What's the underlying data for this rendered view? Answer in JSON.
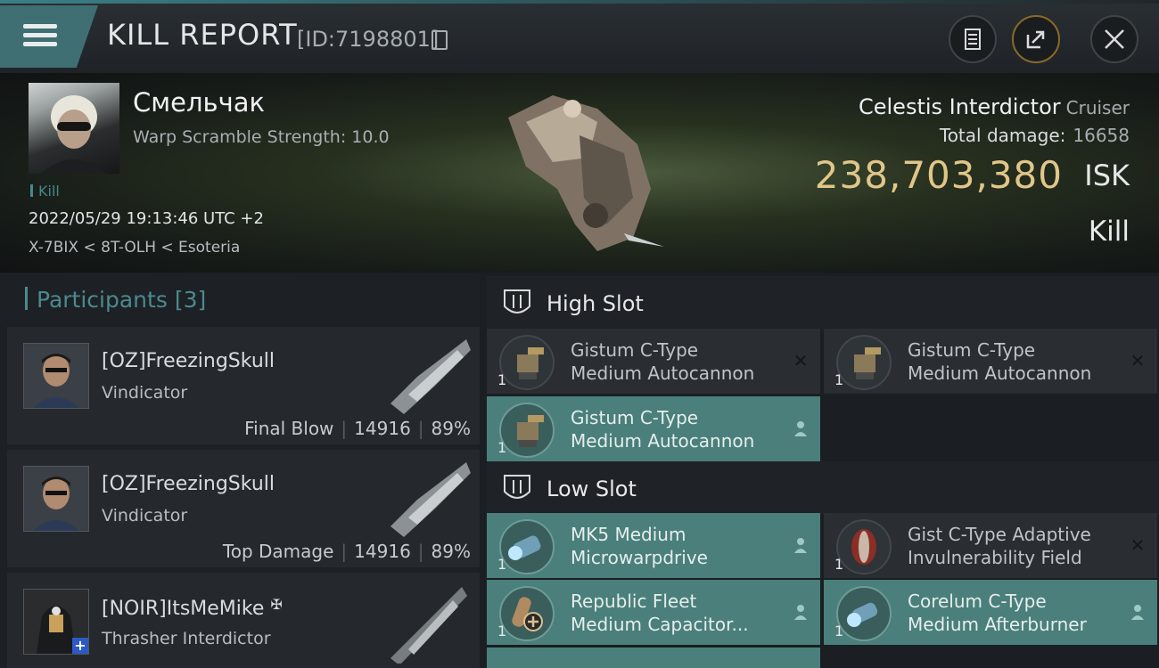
{
  "header": {
    "title": "KILL REPORT",
    "report_id": "[ID:7198801]",
    "icons": [
      "menu-icon",
      "copy-icon",
      "clipboard-icon",
      "share-icon",
      "close-icon"
    ]
  },
  "victim": {
    "name": "Смельчак",
    "warp_scramble": "Warp Scramble Strength: 10.0",
    "tag": "Kill",
    "datetime": "2022/05/29 19:13:46 UTC +2",
    "location": "X-7BIX < 8T-OLH < Esoteria",
    "ship_name": "Celestis Interdictor",
    "ship_class": "Cruiser",
    "total_damage_label": "Total damage:",
    "total_damage": "16658",
    "isk_value": "238,703,380",
    "isk_unit": "ISK",
    "result": "Kill"
  },
  "participants": {
    "label": "Participants",
    "count": "[3]",
    "rows": [
      {
        "name": "[OZ]FreezingSkull",
        "ship": "Vindicator",
        "role": "Final Blow",
        "damage": "14916",
        "percent": "89%"
      },
      {
        "name": "[OZ]FreezingSkull",
        "ship": "Vindicator",
        "role": "Top Damage",
        "damage": "14916",
        "percent": "89%"
      },
      {
        "name": "[NOIR]ItsMeMike",
        "ship": "Thrasher Interdictor",
        "badge": "✠"
      }
    ]
  },
  "high_slot": {
    "label": "High Slot",
    "items": [
      {
        "line1": "Gistum C-Type",
        "line2": "Medium Autocannon",
        "qty": "1",
        "status": "destroyed"
      },
      {
        "line1": "Gistum C-Type",
        "line2": "Medium Autocannon",
        "qty": "1",
        "status": "destroyed"
      },
      {
        "line1": "Gistum C-Type",
        "line2": "Medium Autocannon",
        "qty": "1",
        "status": "dropped"
      }
    ]
  },
  "low_slot": {
    "label": "Low Slot",
    "items": [
      {
        "line1": "MK5 Medium",
        "line2": "Microwarpdrive",
        "qty": "1",
        "status": "dropped"
      },
      {
        "line1": "Gist C-Type Adaptive",
        "line2": "Invulnerability Field",
        "qty": "1",
        "status": "destroyed"
      },
      {
        "line1": "Republic Fleet",
        "line2": "Medium Capacitor...",
        "qty": "1",
        "status": "dropped"
      },
      {
        "line1": "Corelum C-Type",
        "line2": "Medium Afterburner",
        "qty": "1",
        "status": "dropped"
      }
    ]
  },
  "colors": {
    "accent_teal": "#4a8a8e",
    "isk_gold": "#e0c688",
    "dropped_bg": "#4a7f7b",
    "destroyed_bg": "#2a2e32"
  }
}
